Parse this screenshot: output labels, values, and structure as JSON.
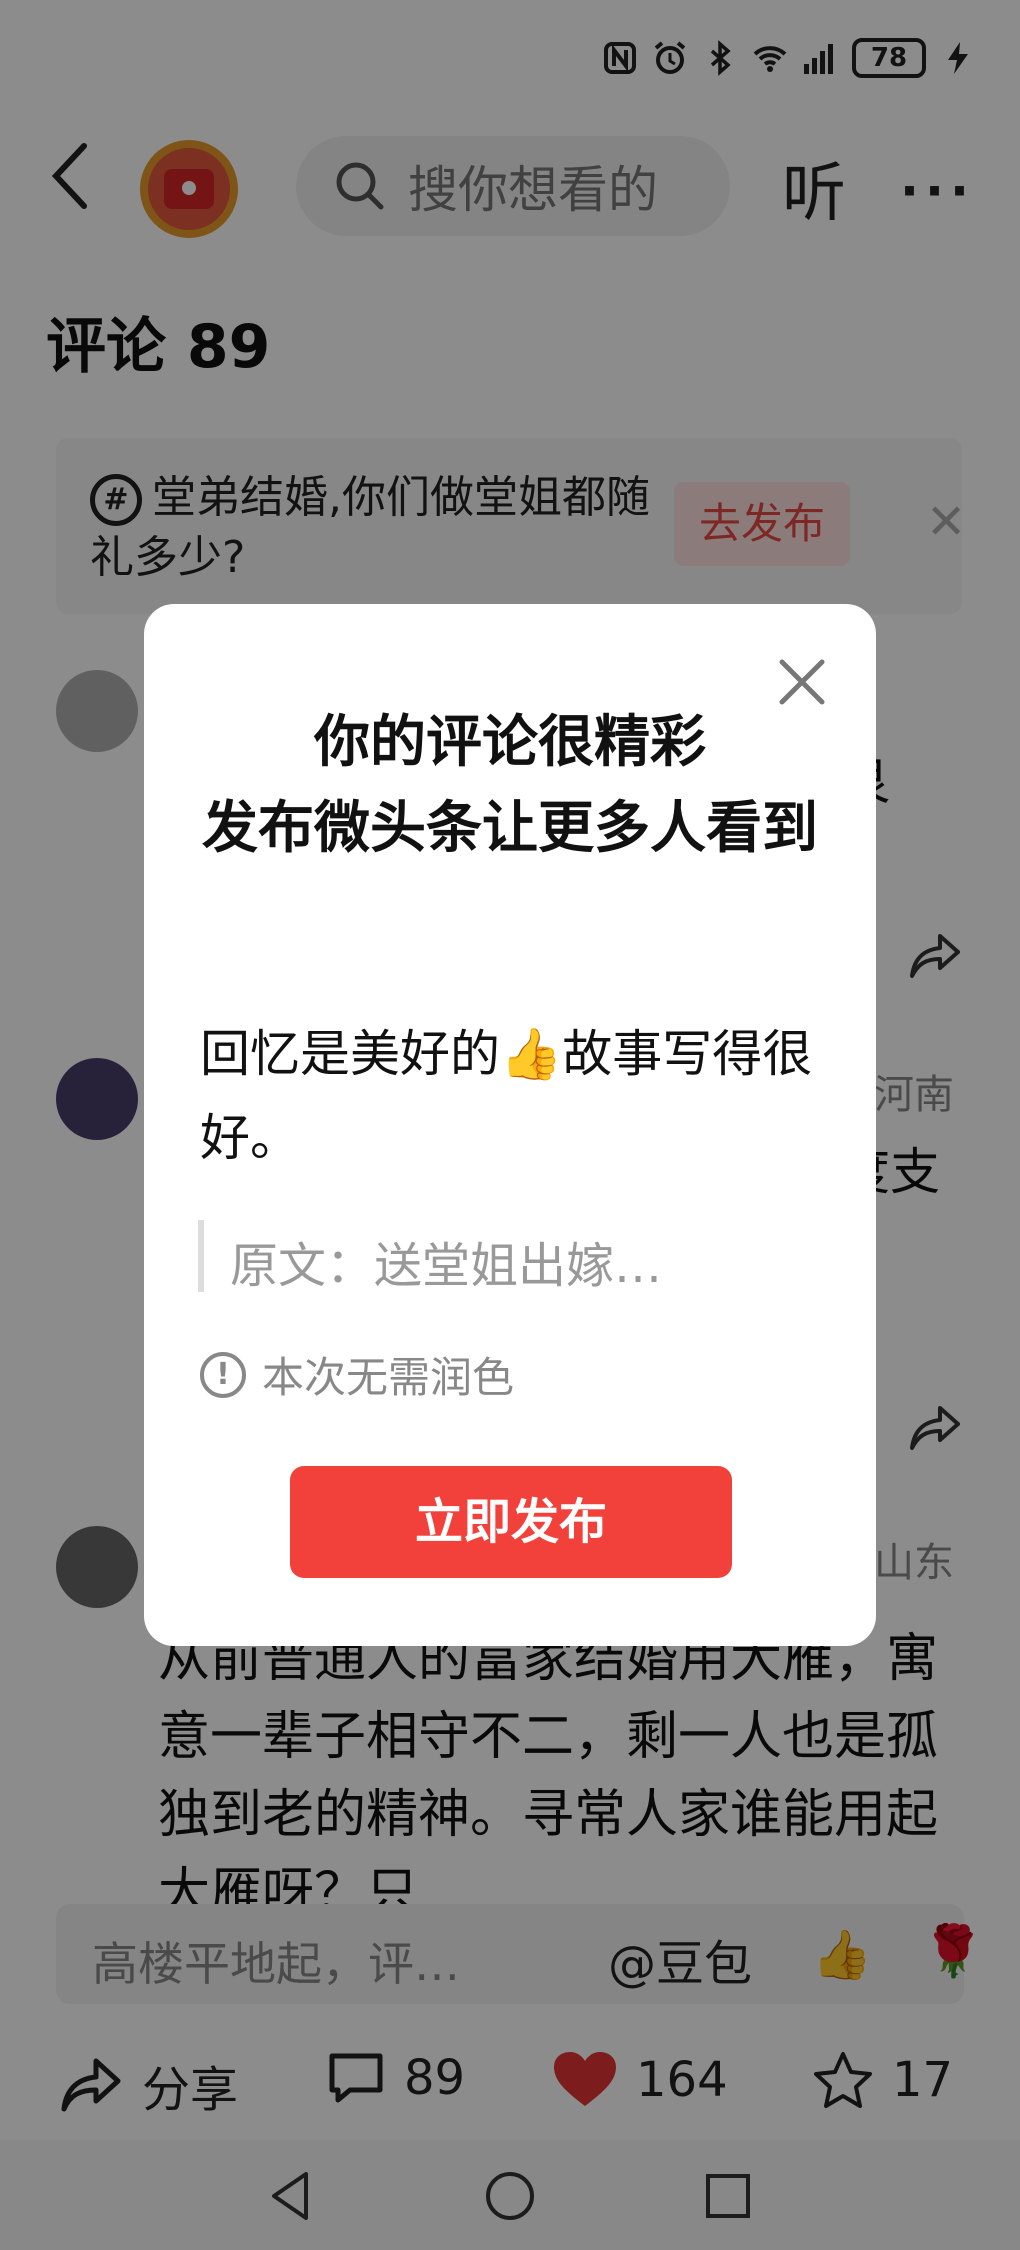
{
  "status_bar": {
    "carrier_text": "",
    "battery": "78"
  },
  "header": {
    "search_placeholder": "搜你想看的",
    "listen_label": "听",
    "more_label": "···"
  },
  "comments": {
    "title": "评论 89"
  },
  "topic": {
    "text": "堂弟结婚,你们做堂姐都随礼多少?",
    "publish_label": "去发布",
    "close_label": "✕"
  },
  "background": {
    "snippet_1": "艮",
    "snippet_2_loc": "河南",
    "snippet_2": "度支",
    "snippet_3_loc": "山东",
    "comment_body": "从前普通人的富家结婚用大雁，寓意一辈子相守不二，剩一人也是孤独到老的精神。寻常人家谁能用起大雁呀？只"
  },
  "input_bar": {
    "placeholder": "高楼平地起，评…",
    "mention": "@豆包",
    "emoji_like": "👍",
    "emoji_rose": "🌹"
  },
  "actions": {
    "share_label": "分享",
    "comment_count": "89",
    "like_count": "164",
    "favorite_count": "17"
  },
  "modal": {
    "title": "你的评论很精彩\n发布微头条让更多人看到",
    "comment_before": "回忆是美好的",
    "comment_emoji": "👍",
    "comment_after": "故事写得很好。",
    "quote": "原文：送堂姐出嫁…",
    "notice": "本次无需润色",
    "notice_icon": "!",
    "publish_label": "立即发布"
  },
  "colors": {
    "accent": "#f2403b",
    "heart": "#e33434"
  }
}
